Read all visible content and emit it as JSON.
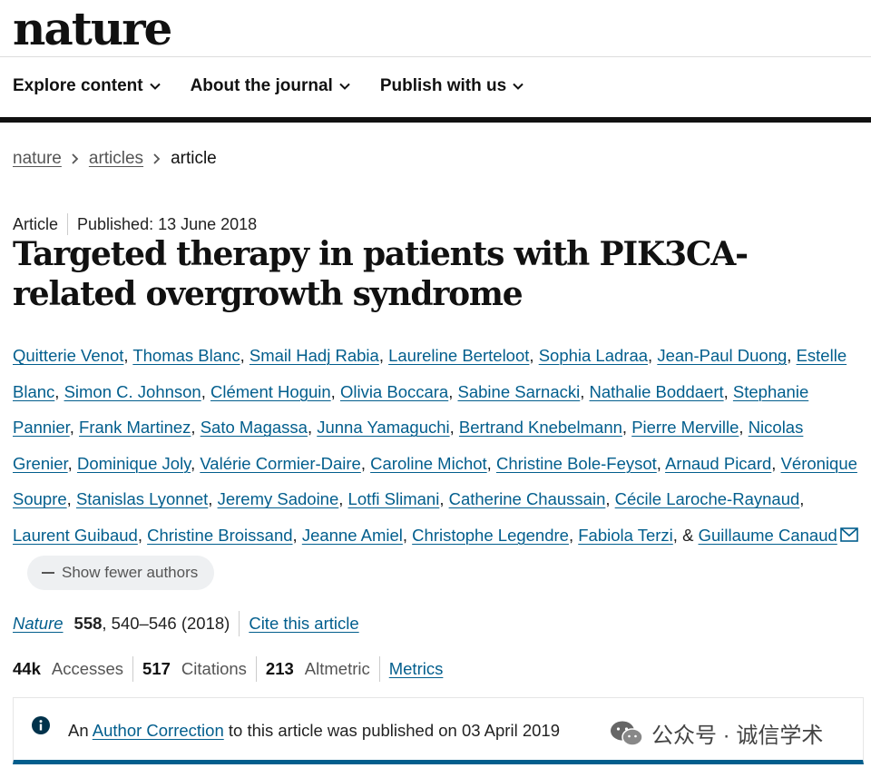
{
  "header": {
    "logo": "nature",
    "nav": [
      {
        "label": "Explore content"
      },
      {
        "label": "About the journal"
      },
      {
        "label": "Publish with us"
      }
    ]
  },
  "breadcrumb": [
    "nature",
    "articles",
    "article"
  ],
  "article": {
    "type": "Article",
    "published": "Published: 13 June 2018",
    "title": "Targeted therapy in patients with PIK3CA-related overgrowth syndrome",
    "authors": [
      "Quitterie Venot",
      "Thomas Blanc",
      "Smail Hadj Rabia",
      "Laureline Berteloot",
      "Sophia Ladraa",
      "Jean-Paul Duong",
      "Estelle Blanc",
      "Simon C. Johnson",
      "Clément Hoguin",
      "Olivia Boccara",
      "Sabine Sarnacki",
      "Nathalie Boddaert",
      "Stephanie Pannier",
      "Frank Martinez",
      "Sato Magassa",
      "Junna Yamaguchi",
      "Bertrand Knebelmann",
      "Pierre Merville",
      "Nicolas Grenier",
      "Dominique Joly",
      "Valérie Cormier-Daire",
      "Caroline Michot",
      "Christine Bole-Feysot",
      "Arnaud Picard",
      "Véronique Soupre",
      "Stanislas Lyonnet",
      "Jeremy Sadoine",
      "Lotfi Slimani",
      "Catherine Chaussain",
      "Cécile Laroche-Raynaud",
      "Laurent Guibaud",
      "Christine Broissand",
      "Jeanne Amiel",
      "Christophe Legendre",
      "Fabiola Terzi"
    ],
    "last_author_prefix": "&",
    "last_author": "Guillaume Canaud",
    "show_fewer_label": "Show fewer authors",
    "citation": {
      "journal": "Nature",
      "volume": "558",
      "pages_year": ", 540–546 (2018)",
      "cite_label": "Cite this article"
    },
    "metrics": {
      "accesses_value": "44k",
      "accesses_label": "Accesses",
      "citations_value": "517",
      "citations_label": "Citations",
      "altmetric_value": "213",
      "altmetric_label": "Altmetric",
      "metrics_link": "Metrics"
    },
    "notice": {
      "prefix": "An",
      "link": "Author Correction",
      "suffix": "to this article was published on 03 April 2019"
    }
  },
  "watermark": "公众号 · 诚信学术",
  "colors": {
    "link": "#025e8d",
    "text": "#222222"
  }
}
